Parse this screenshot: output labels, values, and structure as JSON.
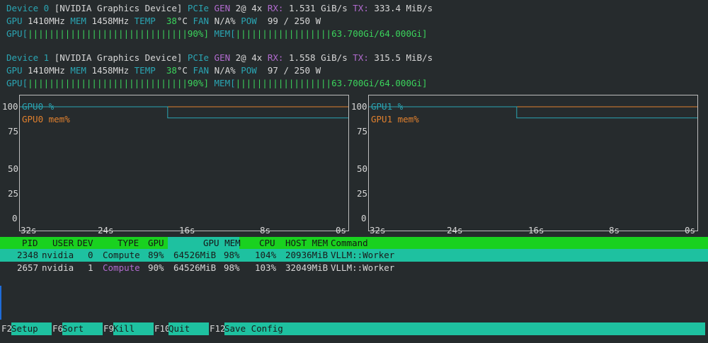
{
  "devices": [
    {
      "name": "Device 0",
      "model": "[NVIDIA Graphics Device]",
      "pcie_label": "PCIe",
      "gen_label": "GEN",
      "gen": "2@ 4x",
      "rx_label": "RX:",
      "rx": "1.531 GiB/s",
      "tx_label": "TX:",
      "tx": "333.4 MiB/s",
      "gpu_label": "GPU",
      "gpu_clock": "1410MHz",
      "mem_label": "MEM",
      "mem_clock": "1458MHz",
      "temp_label": "TEMP",
      "temp": "38",
      "temp_unit": "°C",
      "fan_label": "FAN",
      "fan": "N/A%",
      "pow_label": "POW",
      "pow": "99 / 250 W",
      "gpu_bar_label": "GPU[",
      "gpu_bar": "||||||||||||||||||||||||||||||90%]",
      "gpu_util_percent": 90,
      "mem_bar_label": "MEM[",
      "mem_bar": "||||||||||||||||||63.700Gi/64.000Gi]"
    },
    {
      "name": "Device 1",
      "model": "[NVIDIA Graphics Device]",
      "pcie_label": "PCIe",
      "gen_label": "GEN",
      "gen": "2@ 4x",
      "rx_label": "RX:",
      "rx": "1.558 GiB/s",
      "tx_label": "TX:",
      "tx": "315.5 MiB/s",
      "gpu_label": "GPU",
      "gpu_clock": "1410MHz",
      "mem_label": "MEM",
      "mem_clock": "1458MHz",
      "temp_label": "TEMP",
      "temp": "38",
      "temp_unit": "°C",
      "fan_label": "FAN",
      "fan": "N/A%",
      "pow_label": "POW",
      "pow": "97 / 250 W",
      "gpu_bar_label": "GPU[",
      "gpu_bar": "||||||||||||||||||||||||||||||90%]",
      "gpu_util_percent": 90,
      "mem_bar_label": "MEM[",
      "mem_bar": "||||||||||||||||||63.700Gi/64.000Gi]"
    }
  ],
  "charts": [
    {
      "y_ticks": [
        "100",
        "75",
        "50",
        "25",
        "0"
      ],
      "x_ticks": [
        "32s",
        "24s",
        "16s",
        "8s",
        "0s"
      ],
      "legend": [
        {
          "label": "GPU0 %",
          "color": "#2aa5b3"
        },
        {
          "label": "GPU0 mem%",
          "color": "#e0802e"
        }
      ],
      "gpu_series": [
        100,
        100,
        100,
        90,
        90,
        90
      ],
      "mem_series": [
        100,
        100,
        100,
        100,
        100,
        100
      ]
    },
    {
      "y_ticks": [
        "100",
        "75",
        "50",
        "25",
        "0"
      ],
      "x_ticks": [
        "32s",
        "24s",
        "16s",
        "8s",
        "0s"
      ],
      "legend": [
        {
          "label": "GPU1 %",
          "color": "#2aa5b3"
        },
        {
          "label": "GPU1 mem%",
          "color": "#e0802e"
        }
      ],
      "gpu_series": [
        100,
        100,
        100,
        90,
        90,
        90
      ],
      "mem_series": [
        100,
        100,
        100,
        100,
        100,
        100
      ]
    }
  ],
  "process_table": {
    "headers": {
      "pid": "PID",
      "user": "USER",
      "dev": "DEV",
      "type": "TYPE",
      "gpu": "GPU",
      "gpu_mem": "GPU MEM",
      "cpu": "CPU",
      "host_mem": "HOST MEM",
      "command": "Command"
    },
    "rows": [
      {
        "pid": "2348",
        "user": "nvidia",
        "dev": "0",
        "type": "Compute",
        "gpu": "89%",
        "gpu_mem": "64526MiB",
        "gpu_mem_pct": "98%",
        "cpu": "104%",
        "host_mem": "20936MiB",
        "command": "VLLM::Worker"
      },
      {
        "pid": "2657",
        "user": "nvidia",
        "dev": "1",
        "type": "Compute",
        "gpu": "90%",
        "gpu_mem": "64526MiB",
        "gpu_mem_pct": "98%",
        "cpu": "103%",
        "host_mem": "32049MiB",
        "command": "VLLM::Worker"
      }
    ]
  },
  "function_keys": [
    {
      "key": "F2",
      "label": "Setup"
    },
    {
      "key": "F6",
      "label": "Sort"
    },
    {
      "key": "F9",
      "label": "Kill"
    },
    {
      "key": "F10",
      "label": "Quit"
    },
    {
      "key": "F12",
      "label": "Save Config"
    }
  ],
  "colors": {
    "background": "#262b2d",
    "teal": "#2aa5b3",
    "magenta": "#b26bcf",
    "green": "#3bd45c",
    "orange": "#e0802e",
    "header_green": "#19d11f",
    "selection": "#1ec1a0"
  }
}
